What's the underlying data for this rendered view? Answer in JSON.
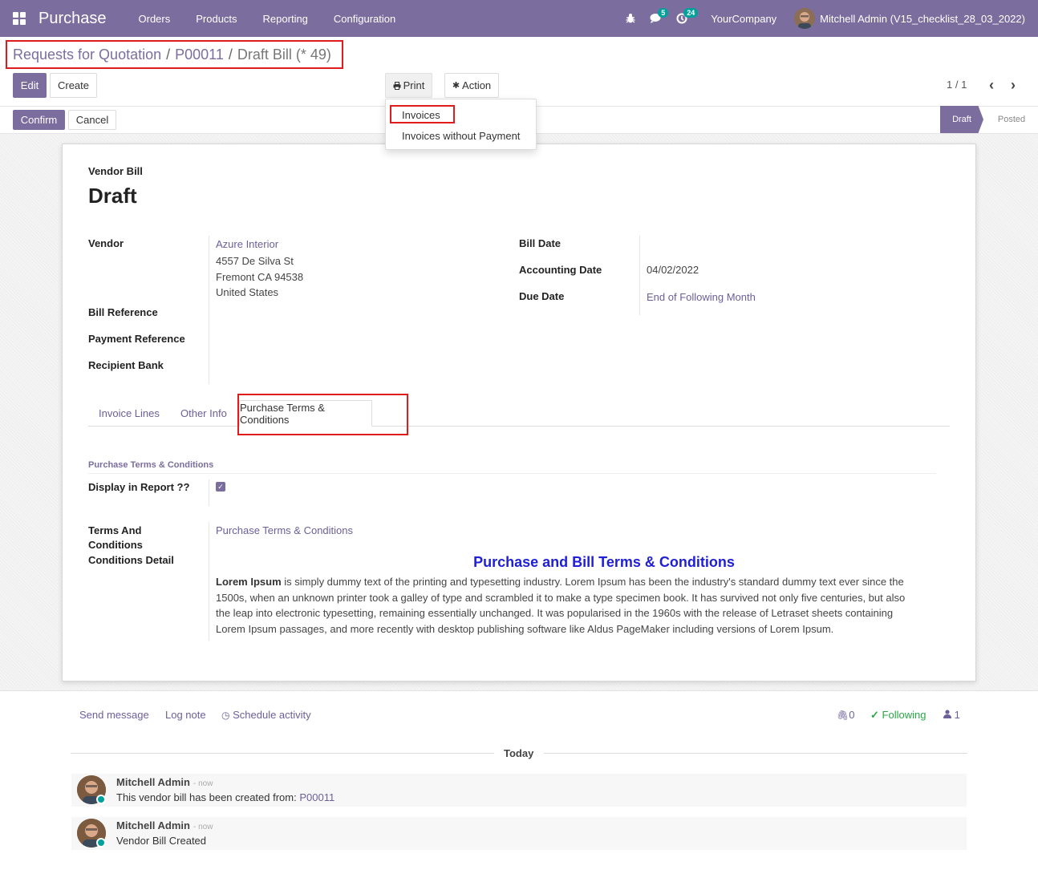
{
  "nav": {
    "brand": "Purchase",
    "menu": [
      "Orders",
      "Products",
      "Reporting",
      "Configuration"
    ],
    "messages_badge": "5",
    "activities_badge": "24",
    "company": "YourCompany",
    "user": "Mitchell Admin (V15_checklist_28_03_2022)"
  },
  "breadcrumb": {
    "items": [
      "Requests for Quotation",
      "P00011"
    ],
    "current": "Draft Bill (* 49)",
    "separator": "/"
  },
  "toolbar": {
    "edit": "Edit",
    "create": "Create",
    "print": "Print",
    "action": "Action",
    "pager": "1 / 1"
  },
  "print_menu": [
    "Invoices",
    "Invoices without Payment"
  ],
  "statusbar": {
    "confirm": "Confirm",
    "cancel": "Cancel",
    "stages": [
      "Draft",
      "Posted"
    ]
  },
  "form": {
    "subtitle": "Vendor Bill",
    "title": "Draft",
    "labels": {
      "vendor": "Vendor",
      "bill_reference": "Bill Reference",
      "payment_reference": "Payment Reference",
      "recipient_bank": "Recipient Bank",
      "bill_date": "Bill Date",
      "accounting_date": "Accounting Date",
      "due_date": "Due Date"
    },
    "vendor": {
      "name": "Azure Interior",
      "street": "4557 De Silva St",
      "city": "Fremont CA 94538",
      "country": "United States"
    },
    "accounting_date": "04/02/2022",
    "due_date": "End of Following Month",
    "tabs": [
      "Invoice Lines",
      "Other Info",
      "Purchase Terms & Conditions"
    ],
    "terms_section": "Purchase Terms & Conditions",
    "display_in_report_label": "Display in Report ??",
    "display_in_report": true,
    "terms_label": "Terms And Conditions",
    "conditions_detail_label": "Conditions Detail",
    "terms_value": "Purchase Terms & Conditions",
    "terms_heading": "Purchase and Bill Terms & Conditions",
    "terms_bold": "Lorem Ipsum",
    "terms_text": " is simply dummy text of the printing and typesetting industry. Lorem Ipsum has been the industry's standard dummy text ever since the 1500s, when an unknown printer took a galley of type and scrambled it to make a type specimen book. It has survived not only five centuries, but also the leap into electronic typesetting, remaining essentially unchanged. It was popularised in the 1960s with the release of Letraset sheets containing Lorem Ipsum passages, and more recently with desktop publishing software like Aldus PageMaker including versions of Lorem Ipsum."
  },
  "chatter": {
    "send_message": "Send message",
    "log_note": "Log note",
    "schedule_activity": "Schedule activity",
    "attachments": "0",
    "following": "Following",
    "followers": "1",
    "today": "Today",
    "messages": [
      {
        "author": "Mitchell Admin",
        "date": "- now",
        "text": "This vendor bill has been created from: ",
        "link": "P00011"
      },
      {
        "author": "Mitchell Admin",
        "date": "- now",
        "text": "Vendor Bill Created"
      }
    ]
  },
  "colors": {
    "brand": "#7c6d9f",
    "accent": "#00a09d",
    "highlight": "#e01b1b",
    "terms_heading": "#1f1fd6"
  }
}
